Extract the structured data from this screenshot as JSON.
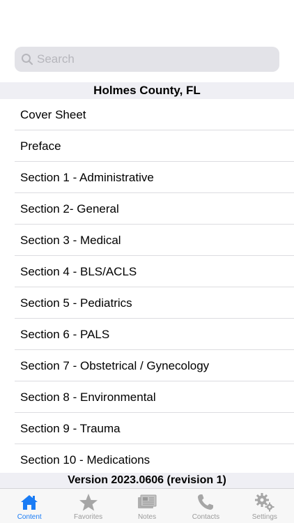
{
  "search": {
    "placeholder": "Search"
  },
  "header": {
    "title": "Holmes County, FL"
  },
  "list": {
    "items": [
      "Cover Sheet",
      "Preface",
      "Section 1 - Administrative",
      "Section 2- General",
      "Section 3 - Medical",
      "Section 4 - BLS/ACLS",
      "Section 5 - Pediatrics",
      "Section 6 - PALS",
      "Section 7 - Obstetrical / Gynecology",
      "Section 8 - Environmental",
      "Section 9 - Trauma",
      "Section 10 - Medications"
    ]
  },
  "footer": {
    "version": "Version 2023.0606 (revision 1)"
  },
  "tabs": [
    {
      "label": "Content",
      "icon": "house-icon",
      "active": true
    },
    {
      "label": "Favorites",
      "icon": "star-icon",
      "active": false
    },
    {
      "label": "Notes",
      "icon": "notes-icon",
      "active": false
    },
    {
      "label": "Contacts",
      "icon": "phone-icon",
      "active": false
    },
    {
      "label": "Settings",
      "icon": "gear-icon",
      "active": false
    }
  ],
  "colors": {
    "accent": "#1a7cf5",
    "inactive": "#9b9b9b",
    "header_bg": "#efeff4",
    "search_bg": "#e3e3e8"
  }
}
